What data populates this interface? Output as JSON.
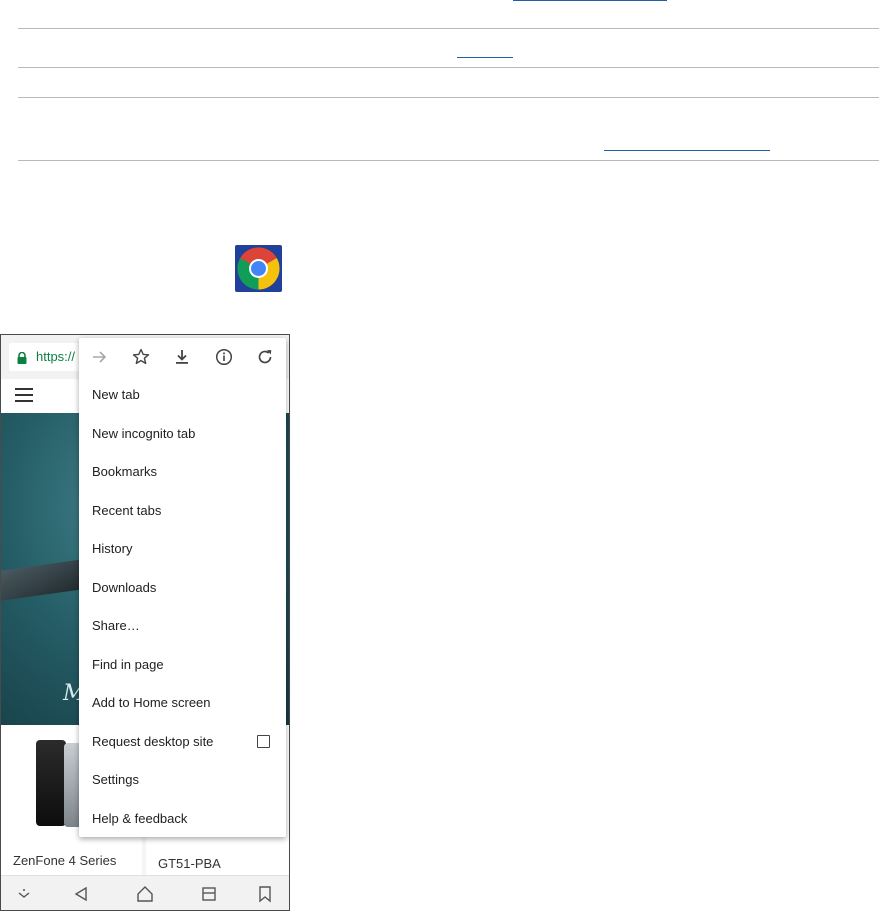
{
  "browser": {
    "url_text": "https://",
    "menu": {
      "icons": [
        "forward-icon",
        "star-icon",
        "download-icon",
        "info-icon",
        "refresh-icon"
      ],
      "items": [
        {
          "label": "New tab"
        },
        {
          "label": "New incognito tab"
        },
        {
          "label": "Bookmarks"
        },
        {
          "label": "Recent tabs"
        },
        {
          "label": "History"
        },
        {
          "label": "Downloads"
        },
        {
          "label": "Share…"
        },
        {
          "label": "Find in page"
        },
        {
          "label": "Add to Home screen"
        },
        {
          "label": "Request desktop site",
          "checkbox": false
        },
        {
          "label": "Settings"
        },
        {
          "label": "Help & feedback"
        }
      ]
    }
  },
  "page": {
    "hero_text": "M",
    "products": [
      {
        "label": "ZenFone 4 Series"
      },
      {
        "label": "GT51-PBA"
      }
    ]
  },
  "colors": {
    "secure_url": "#0b8043",
    "link_underline": "#1f5ea8",
    "hero_teal": "#255d66"
  }
}
